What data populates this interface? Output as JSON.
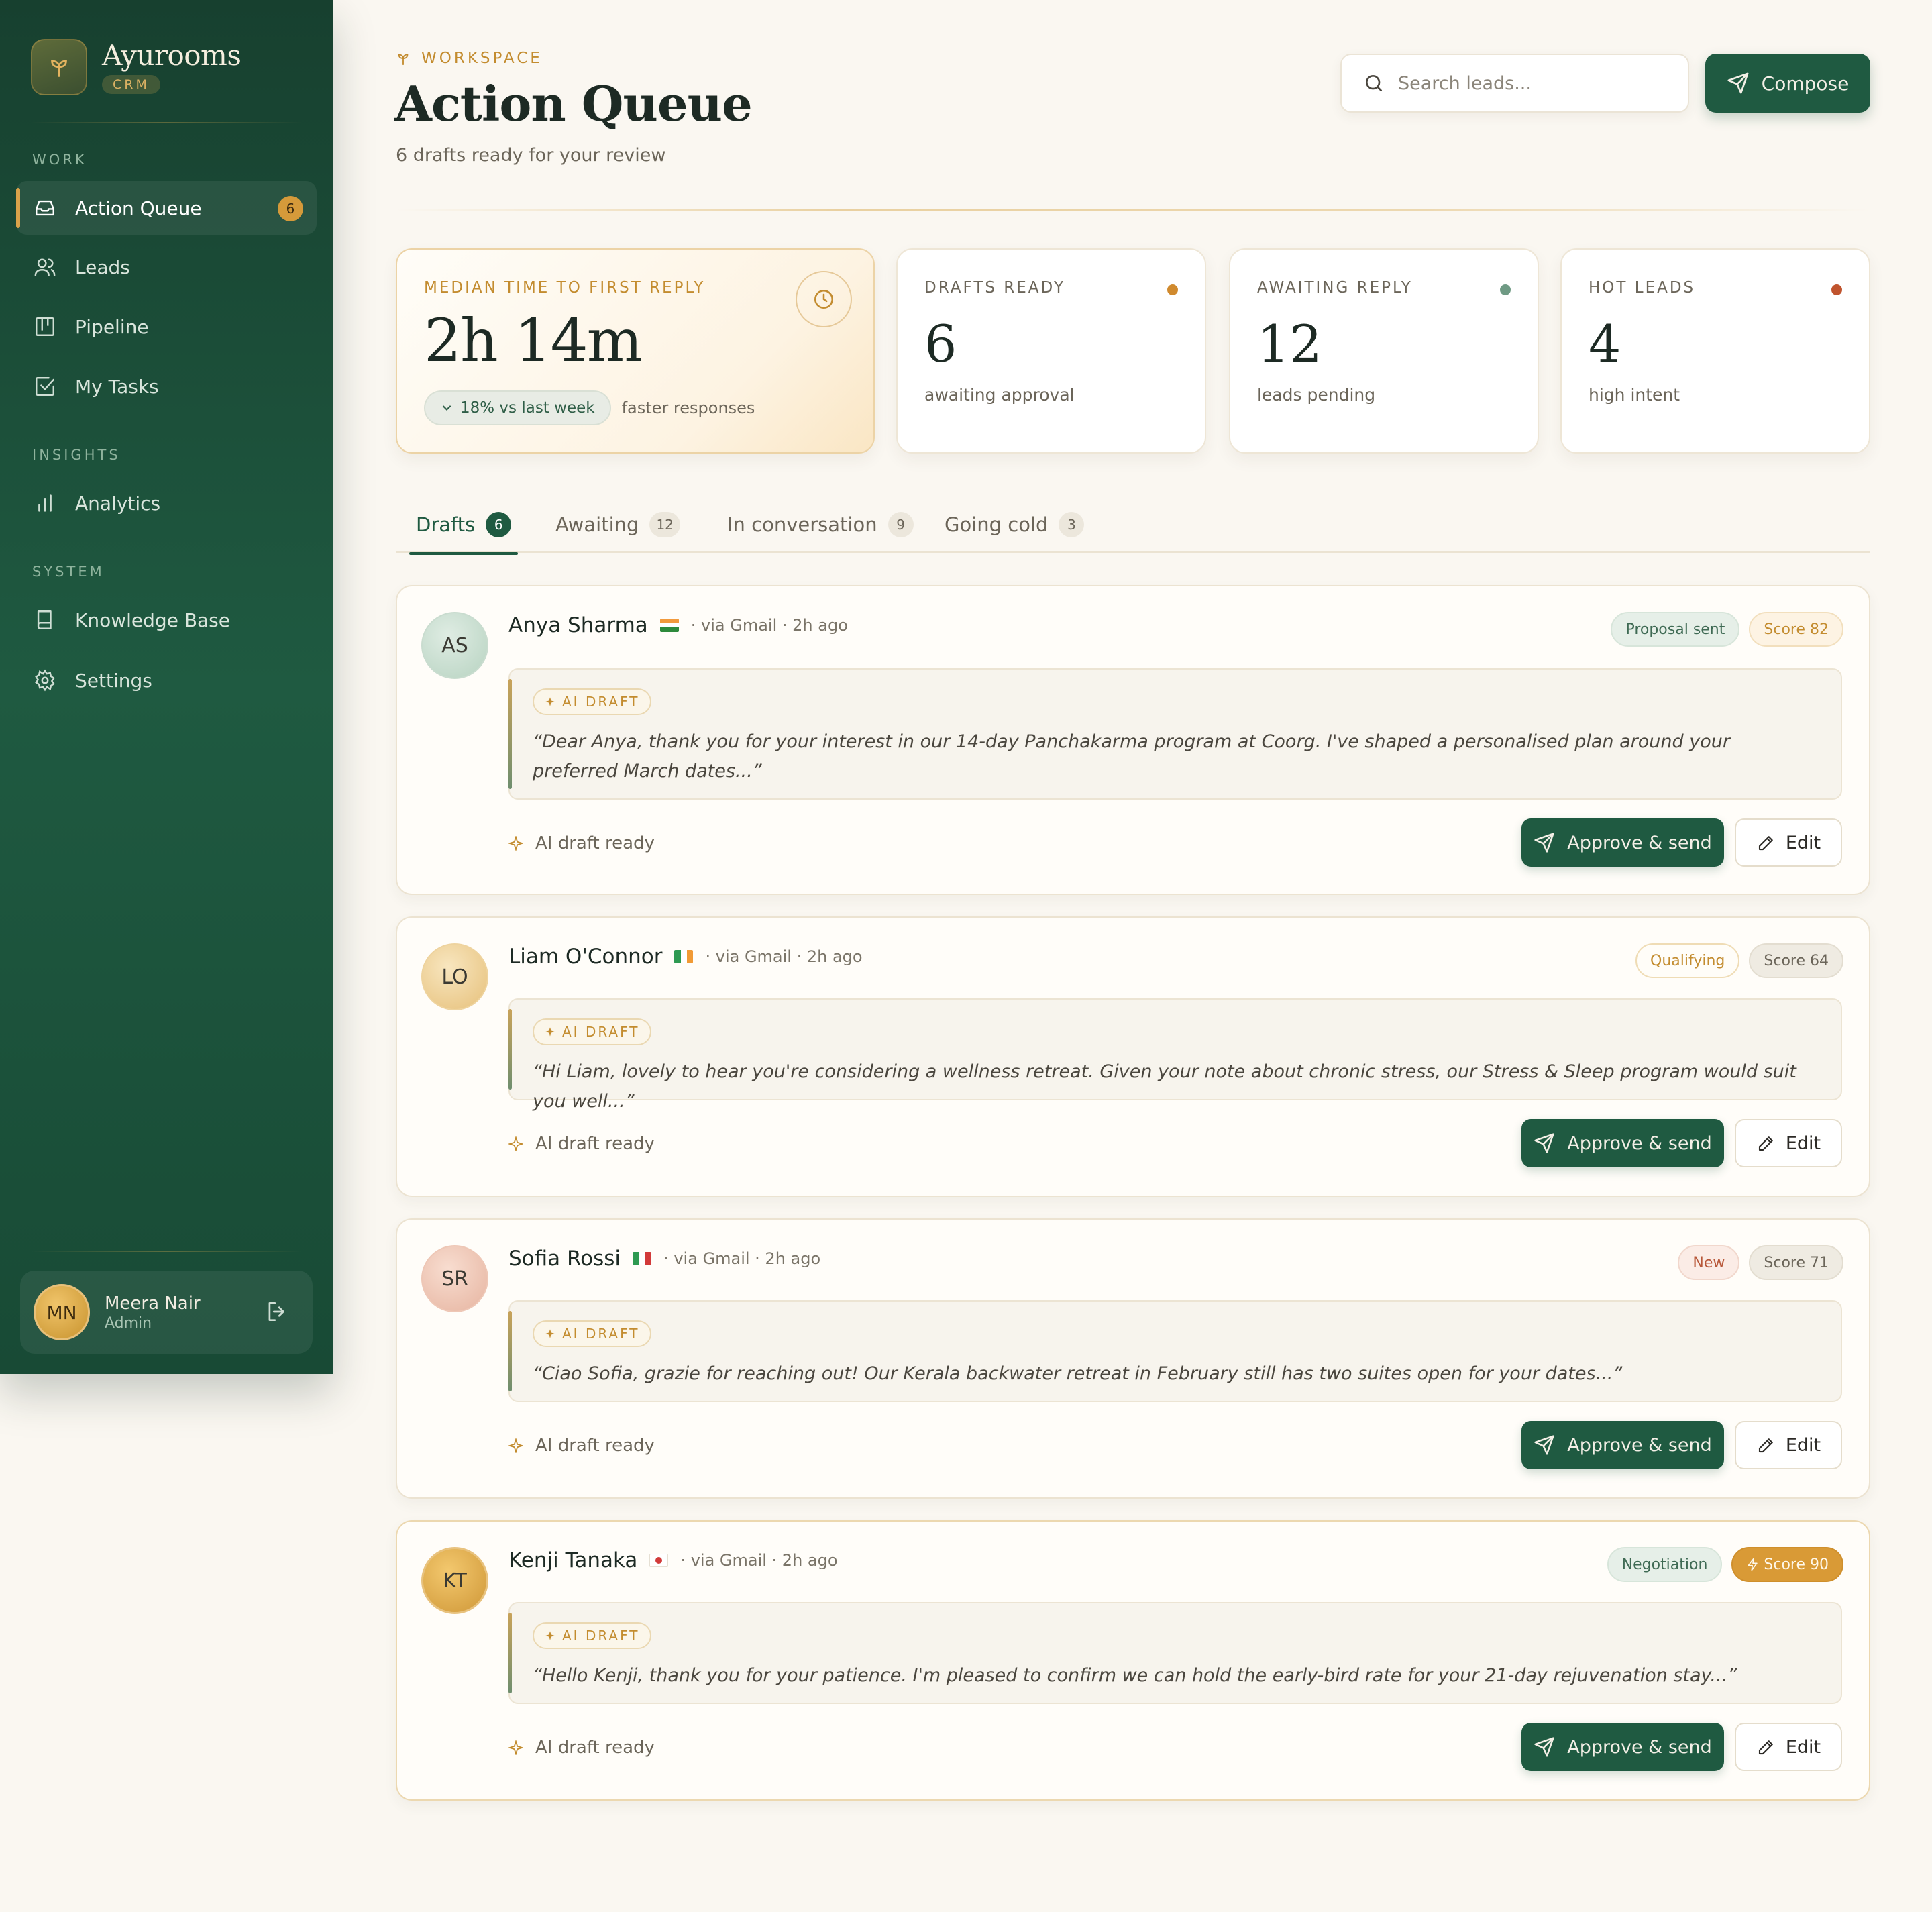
{
  "sidebar": {
    "brand_name": "Ayurooms",
    "brand_tag": "CRM",
    "sections": {
      "work": "WORK",
      "insights": "INSIGHTS",
      "system": "SYSTEM"
    },
    "items": {
      "action_queue": {
        "label": "Action Queue",
        "badge": "6",
        "icon": "inbox-icon"
      },
      "leads": {
        "label": "Leads",
        "icon": "users-icon"
      },
      "pipeline": {
        "label": "Pipeline",
        "icon": "kanban-icon"
      },
      "tasks": {
        "label": "My Tasks",
        "icon": "check-square-icon"
      },
      "analytics": {
        "label": "Analytics",
        "icon": "bar-chart-icon"
      },
      "knowledge": {
        "label": "Knowledge Base",
        "icon": "book-icon"
      },
      "settings": {
        "label": "Settings",
        "icon": "gear-icon"
      }
    },
    "user": {
      "initials": "MN",
      "name": "Meera Nair",
      "role": "Admin"
    }
  },
  "header": {
    "eyebrow": "WORKSPACE",
    "title": "Action Queue",
    "subtitle": "6 drafts ready for your review",
    "search_placeholder": "Search leads...",
    "compose_label": "Compose"
  },
  "stats": {
    "median": {
      "label": "MEDIAN TIME TO FIRST REPLY",
      "value": "2h 14m",
      "trend": "18% vs last week",
      "trend_note": "faster responses"
    },
    "drafts": {
      "label": "DRAFTS READY",
      "value": "6",
      "note": "awaiting approval",
      "dot_color": "#d08a2e"
    },
    "awaiting": {
      "label": "AWAITING REPLY",
      "value": "12",
      "note": "leads pending",
      "dot_color": "#6f9a84"
    },
    "hot": {
      "label": "HOT LEADS",
      "value": "4",
      "note": "high intent",
      "dot_color": "#c0542e"
    }
  },
  "tabs": [
    {
      "label": "Drafts",
      "count": "6"
    },
    {
      "label": "Awaiting",
      "count": "12"
    },
    {
      "label": "In conversation",
      "count": "9"
    },
    {
      "label": "Going cold",
      "count": "3"
    }
  ],
  "leads": [
    {
      "initials": "AS",
      "name": "Anya Sharma",
      "meta": "· via Gmail · 2h ago",
      "stage": "Proposal sent",
      "score": "Score 82",
      "ai_label": "AI DRAFT",
      "draft": "“Dear Anya, thank you for your interest in our 14-day Panchakarma program at Coorg. I've shaped a personalised plan around your preferred March dates...”",
      "status": "AI draft ready",
      "approve": "Approve & send",
      "edit": "Edit"
    },
    {
      "initials": "LO",
      "name": "Liam O'Connor",
      "meta": "· via Gmail · 2h ago",
      "stage": "Qualifying",
      "score": "Score 64",
      "ai_label": "AI DRAFT",
      "draft": "“Hi Liam, lovely to hear you're considering a wellness retreat. Given your note about chronic stress, our Stress & Sleep program would suit you well...”",
      "status": "AI draft ready",
      "approve": "Approve & send",
      "edit": "Edit"
    },
    {
      "initials": "SR",
      "name": "Sofia Rossi",
      "meta": "· via Gmail · 2h ago",
      "stage": "New",
      "score": "Score 71",
      "ai_label": "AI DRAFT",
      "draft": "“Ciao Sofia, grazie for reaching out! Our Kerala backwater retreat in February still has two suites open for your dates...”",
      "status": "AI draft ready",
      "approve": "Approve & send",
      "edit": "Edit"
    },
    {
      "initials": "KT",
      "name": "Kenji Tanaka",
      "meta": "· via Gmail · 2h ago",
      "stage": "Negotiation",
      "score": "Score 90",
      "ai_label": "AI DRAFT",
      "draft": "“Hello Kenji, thank you for your patience. I'm pleased to confirm we can hold the early-bird rate for your 21-day rejuvenation stay...”",
      "status": "AI draft ready",
      "approve": "Approve & send",
      "edit": "Edit"
    }
  ],
  "colors": {
    "brand_green": "#1f5a41",
    "accent_gold": "#c38c2f",
    "background": "#faf7f1"
  }
}
